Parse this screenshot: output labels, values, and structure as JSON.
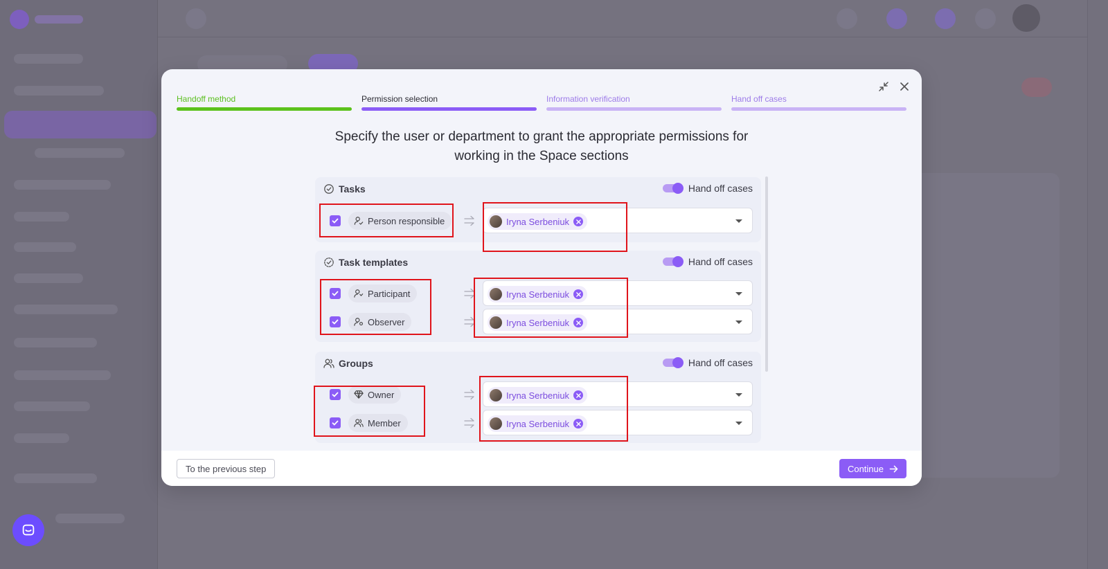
{
  "steps": [
    {
      "label": "Handoff method",
      "state": "done",
      "label_color": "#5bbf1f",
      "bar_color": "#5cc21c"
    },
    {
      "label": "Permission selection",
      "state": "active",
      "label_color": "#2b2b33",
      "bar_color": "#8b5cf6"
    },
    {
      "label": "Information verification",
      "state": "pending",
      "label_color": "#9d7be8",
      "bar_color": "#c9b3f5"
    },
    {
      "label": "Hand off cases",
      "state": "pending",
      "label_color": "#9d7be8",
      "bar_color": "#c9b3f5"
    }
  ],
  "title_line1": "Specify the user or department to grant the appropriate permissions for",
  "title_line2": "working in the Space sections",
  "sections": {
    "tasks": {
      "title": "Tasks",
      "toggle_label": "Hand off cases",
      "toggle_on": true,
      "rows": [
        {
          "role": "Person responsible",
          "checked": true,
          "assignee": "Iryna Serbeniuk"
        }
      ]
    },
    "task_templates": {
      "title": "Task templates",
      "toggle_label": "Hand off cases",
      "toggle_on": true,
      "rows": [
        {
          "role": "Participant",
          "checked": true,
          "assignee": "Iryna Serbeniuk"
        },
        {
          "role": "Observer",
          "checked": true,
          "assignee": "Iryna Serbeniuk"
        }
      ]
    },
    "groups": {
      "title": "Groups",
      "toggle_label": "Hand off cases",
      "toggle_on": true,
      "rows": [
        {
          "role": "Owner",
          "checked": true,
          "assignee": "Iryna Serbeniuk"
        },
        {
          "role": "Member",
          "checked": true,
          "assignee": "Iryna Serbeniuk"
        }
      ]
    }
  },
  "footer": {
    "prev_label": "To the previous step",
    "continue_label": "Continue"
  },
  "colors": {
    "accent": "#8b5cf6",
    "done": "#5cc21c",
    "highlight": "#e0141b"
  },
  "icons": [
    "collapse-icon",
    "close-icon",
    "task-check-icon",
    "task-template-icon",
    "groups-icon",
    "user-check-icon",
    "participant-icon",
    "observer-icon",
    "diamond-icon",
    "member-icon",
    "arrow-right-icon",
    "chat-icon"
  ]
}
